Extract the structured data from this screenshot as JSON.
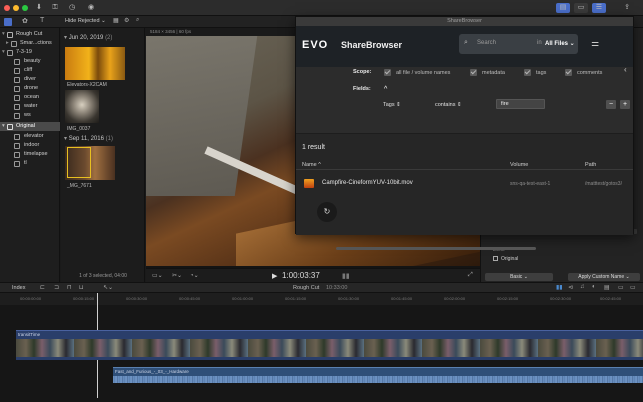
{
  "toolbar": {
    "colors": {
      "close": "#fd5f57",
      "minimize": "#fdbb2e",
      "zoom": "#2ac841"
    }
  },
  "browser": {
    "filter_label": "Hide Rejected",
    "viewer_info": "5184 × 3456 | 60 fps",
    "selection_status": "1 of 3 selected, 04:00",
    "timecode": "1:00:03:37"
  },
  "sidebar": {
    "items": [
      {
        "label": "Rough Cut"
      },
      {
        "label": "Smar...ctions"
      },
      {
        "label": "7-3-19"
      },
      {
        "label": "beauty"
      },
      {
        "label": "cliff"
      },
      {
        "label": "diver"
      },
      {
        "label": "drone"
      },
      {
        "label": "ocean"
      },
      {
        "label": "water"
      },
      {
        "label": "ws"
      },
      {
        "label": "Original"
      },
      {
        "label": "elevator"
      },
      {
        "label": "indoor"
      },
      {
        "label": "timelapse"
      },
      {
        "label": "tl"
      }
    ]
  },
  "clips": {
    "groups": [
      {
        "date": "Jun 20, 2019",
        "count": "(2)"
      },
      {
        "date": "Sep 11, 2016",
        "count": "(1)"
      }
    ],
    "items": [
      {
        "name": "Elevators-X2CAM"
      },
      {
        "name": "IMG_0037"
      },
      {
        "name": "_MG_7671"
      }
    ]
  },
  "sharebrowser": {
    "window_title": "ShareBrowser",
    "logo": "EVO",
    "app_name": "ShareBrowser",
    "search_placeholder": "Search",
    "search_scope_prefix": "in",
    "search_scope": "All Files",
    "scope_label": "Scope:",
    "scope_options": [
      "all file / volume names",
      "metadata",
      "tags",
      "comments"
    ],
    "fields_label": "Fields:",
    "field_name": "Tags",
    "field_operator": "contains",
    "field_value": "fire",
    "result_count": "1 result",
    "columns": {
      "name": "Name",
      "volume": "Volume",
      "path": "Path"
    },
    "results": [
      {
        "name": "Campfire-CineformYUV-10bit.mov",
        "volume": "sns-qa-test-east-1",
        "path": "/matttest/gotos3/"
      }
    ]
  },
  "inspector": {
    "event_label": "Event",
    "event_value": "Original",
    "basic_label": "Basic",
    "apply_label": "Apply Custom Name"
  },
  "timeline": {
    "index_label": "Index",
    "project_name": "Rough Cut",
    "duration": "10:33:00",
    "ruler_labels": [
      "00:00:00:00",
      "00:00:15:00",
      "00:00:30:00",
      "00:00:45:00",
      "00:01:00:00",
      "00:01:15:00",
      "00:01:30:00",
      "00:01:45:00",
      "00:02:00:00",
      "00:02:15:00",
      "00:02:30:00",
      "00:02:45:00"
    ],
    "clip_title": "transitTime",
    "audio_clip": "Fast_and_Furious_-_03_-_Hardware"
  }
}
